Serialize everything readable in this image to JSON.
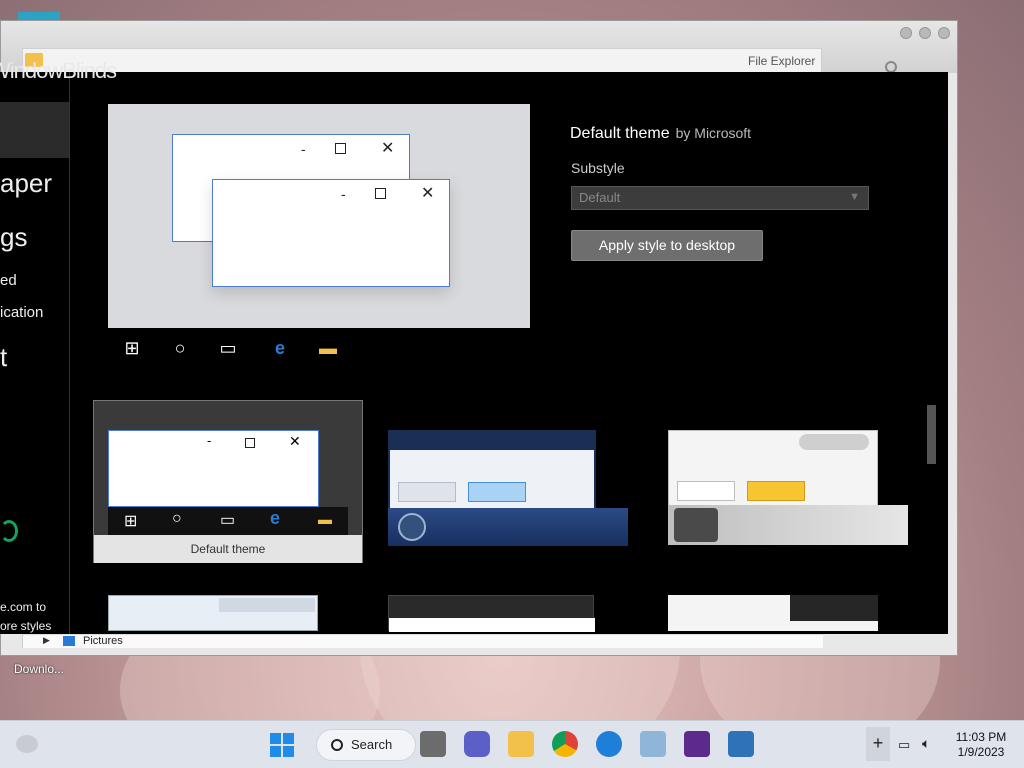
{
  "window": {
    "file_explorer_title": "File Explorer",
    "address_item": "Pictures"
  },
  "windowblinds": {
    "logo": "WindowBlinds",
    "sidebar": {
      "items": [
        "aper",
        "gs",
        "ed",
        "ication",
        "t"
      ],
      "footer": [
        "e.com to",
        "ore styles"
      ]
    },
    "style": {
      "name": "Default theme",
      "author": "by Microsoft",
      "substyle_label": "Substyle",
      "substyle_value": "Default",
      "apply_button": "Apply style to desktop"
    },
    "thumbnails": [
      {
        "caption": "Default theme"
      }
    ]
  },
  "desktop": {
    "download_label": "Downlo..."
  },
  "taskbar": {
    "search_label": "Search",
    "time": "11:03 PM",
    "date": "1/9/2023"
  },
  "colors": {
    "taskbar_bg": "#dfe3ec",
    "accent": "#0067c0",
    "panel_bg": "#000000"
  }
}
